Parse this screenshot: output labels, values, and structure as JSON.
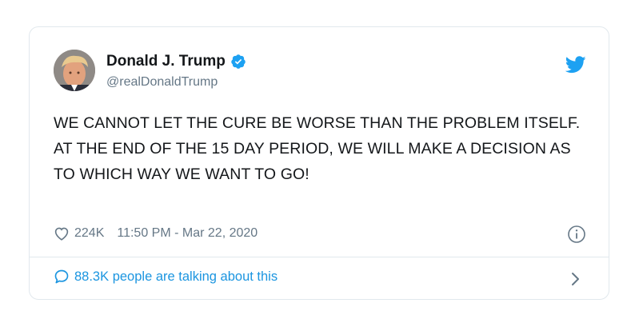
{
  "tweet": {
    "author": {
      "name": "Donald J. Trump",
      "handle": "@realDonaldTrump"
    },
    "text": "WE CANNOT LET THE CURE BE WORSE THAN THE PROBLEM ITSELF. AT THE END OF THE 15 DAY PERIOD, WE WILL MAKE A DECISION AS TO WHICH WAY WE WANT TO GO!",
    "likes": "224K",
    "timestamp": "11:50 PM - Mar 22, 2020",
    "footer": "88.3K people are talking about this"
  },
  "colors": {
    "twitter_blue": "#1da1f2",
    "link_blue": "#1b95e0",
    "secondary_text": "#657786",
    "border": "#e1e8ed"
  },
  "icons": {
    "verified": "verified-badge-icon",
    "brand": "twitter-bird-icon",
    "like": "heart-icon",
    "info": "info-icon",
    "reply": "speech-bubble-icon",
    "navigate": "chevron-right-icon"
  }
}
